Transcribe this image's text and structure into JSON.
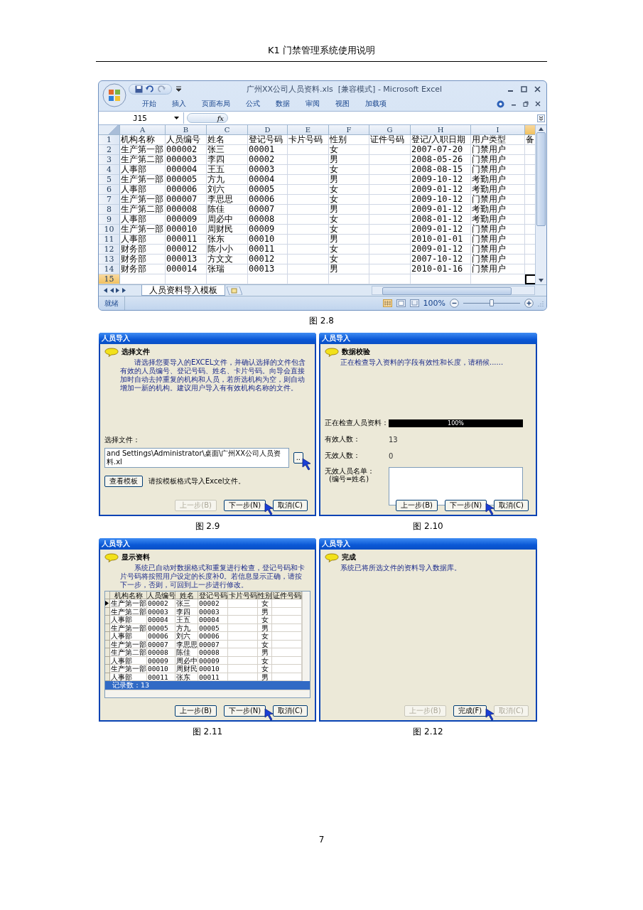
{
  "header": {
    "title": "K1 门禁管理系统使用说明"
  },
  "excel": {
    "title": "广州XX公司人员资料.xls  [兼容模式] - Microsoft Excel",
    "ribbon_tabs": [
      "开始",
      "插入",
      "页面布局",
      "公式",
      "数据",
      "审阅",
      "视图",
      "加载项"
    ],
    "name_box": "J15",
    "formula_label": "fx",
    "columns": [
      {
        "letter": "A",
        "selected": false
      },
      {
        "letter": "B",
        "selected": false
      },
      {
        "letter": "C",
        "selected": false
      },
      {
        "letter": "D",
        "selected": false
      },
      {
        "letter": "E",
        "selected": false
      },
      {
        "letter": "F",
        "selected": false
      },
      {
        "letter": "G",
        "selected": false
      },
      {
        "letter": "H",
        "selected": false
      },
      {
        "letter": "I",
        "selected": false
      },
      {
        "selected": true
      }
    ],
    "rows": [
      {
        "num": "1",
        "selected": false,
        "cells": [
          "机构名称",
          "人员编号",
          "姓名",
          "登记号码",
          "卡片号码",
          "性别",
          "证件号码",
          "登记/入职日期",
          "用户类型",
          "备"
        ]
      },
      {
        "num": "2",
        "selected": false,
        "cells": [
          "生产第一部",
          "000002",
          "张三",
          "00001",
          null,
          "女",
          null,
          "2007-07-20",
          "门禁用户",
          null
        ]
      },
      {
        "num": "3",
        "selected": false,
        "cells": [
          "生产第二部",
          "000003",
          "李四",
          "00002",
          null,
          "男",
          null,
          "2008-05-26",
          "门禁用户",
          null
        ]
      },
      {
        "num": "4",
        "selected": false,
        "cells": [
          "人事部",
          "000004",
          "王五",
          "00003",
          null,
          "女",
          null,
          "2008-08-15",
          "门禁用户",
          null
        ]
      },
      {
        "num": "5",
        "selected": false,
        "cells": [
          "生产第一部",
          "000005",
          "方九",
          "00004",
          null,
          "男",
          null,
          "2009-10-12",
          "考勤用户",
          null
        ]
      },
      {
        "num": "6",
        "selected": false,
        "cells": [
          "人事部",
          "000006",
          "刘六",
          "00005",
          null,
          "女",
          null,
          "2009-01-12",
          "考勤用户",
          null
        ]
      },
      {
        "num": "7",
        "selected": false,
        "cells": [
          "生产第一部",
          "000007",
          "李思思",
          "00006",
          null,
          "女",
          null,
          "2009-10-12",
          "门禁用户",
          null
        ]
      },
      {
        "num": "8",
        "selected": false,
        "cells": [
          "生产第二部",
          "000008",
          "陈佳",
          "00007",
          null,
          "男",
          null,
          "2009-01-12",
          "考勤用户",
          null
        ]
      },
      {
        "num": "9",
        "selected": false,
        "cells": [
          "人事部",
          "000009",
          "周必中",
          "00008",
          null,
          "女",
          null,
          "2008-01-12",
          "考勤用户",
          null
        ]
      },
      {
        "num": "10",
        "selected": false,
        "cells": [
          "生产第一部",
          "000010",
          "周财民",
          "00009",
          null,
          "女",
          null,
          "2009-01-12",
          "门禁用户",
          null
        ]
      },
      {
        "num": "11",
        "selected": false,
        "cells": [
          "人事部",
          "000011",
          "张东",
          "00010",
          null,
          "男",
          null,
          "2010-01-01",
          "门禁用户",
          null
        ]
      },
      {
        "num": "12",
        "selected": false,
        "cells": [
          "财务部",
          "000012",
          "陈小小",
          "00011",
          null,
          "女",
          null,
          "2009-01-12",
          "门禁用户",
          null
        ]
      },
      {
        "num": "13",
        "selected": false,
        "cells": [
          "财务部",
          "000013",
          "方文文",
          "00012",
          null,
          "女",
          null,
          "2007-10-12",
          "门禁用户",
          null
        ]
      },
      {
        "num": "14",
        "selected": false,
        "cells": [
          "财务部",
          "000014",
          "张瑞",
          "00013",
          null,
          "男",
          null,
          "2010-01-16",
          "门禁用户",
          null
        ]
      },
      {
        "num": "15",
        "selected": true
      }
    ],
    "sheet_tab": "人员资料导入模板",
    "status": "就绪",
    "zoom": "100%",
    "zoom_slider": {
      "level": 0.5
    },
    "caption": "图 2.8"
  },
  "dialogs": [
    {
      "kind": "file",
      "title": "人员导入",
      "heading": "选择文件",
      "description": "请选择您要导入的EXCEL文件，并确认选择的文件包含有效的人员编号、登记号码、姓名、卡片号码。向导会直接加时自动去掉重复的机构和人员，若所选机构为空，则自动增加一新的机构。建议用户导入有有效机构名称的文件。",
      "file_label": "选择文件：",
      "file_path": "and Settings\\Administrator\\桌面\\广州XX公司人员资料.xl",
      "browse": {
        "label": "..",
        "cursor": true
      },
      "template_button": "查看模板",
      "template_note": "请按模板格式导入Excel文件。",
      "buttons": [
        {
          "label": "上一步(B)",
          "disabled": true,
          "cursor": false
        },
        {
          "label": "下一步(N)",
          "disabled": false,
          "cursor": true
        },
        {
          "label": "取消(C)",
          "disabled": false,
          "cursor": false
        }
      ],
      "caption": "图 2.9"
    },
    {
      "kind": "check",
      "title": "人员导入",
      "heading": "数据校验",
      "description": "正在检查导入资料的字段有效性和长度，请稍候......",
      "progress_label": "正在检查人员资料：",
      "progress": {
        "level": 1,
        "text": "100%"
      },
      "valid_label": "有效人数：",
      "valid_count": "13",
      "invalid_label": "无效人数：",
      "invalid_count": "0",
      "invalid_list_label": "无效人员名单：",
      "invalid_list_hint": "(编号=姓名)",
      "buttons": [
        {
          "label": "上一步(B)",
          "disabled": false,
          "cursor": false
        },
        {
          "label": "下一步(N)",
          "disabled": false,
          "cursor": true
        },
        {
          "label": "取消(C)",
          "disabled": false,
          "cursor": false
        }
      ],
      "caption": "图 2.10"
    },
    {
      "kind": "preview",
      "title": "人员导入",
      "heading": "显示资料",
      "description": "系统已自动对数据格式和重复进行检查，登记号码和卡片号码将按照用户设定的长度补0。若信息显示正确，请按下一步，否则，可回到上一步进行修改。",
      "table": {
        "columns": [
          "机构名称",
          "人员编号",
          "姓名",
          "登记号码",
          "卡片号码",
          "性别",
          "证件号码"
        ],
        "rows": [
          {
            "selected": true,
            "cells": [
              "生产第一部",
              "00002",
              "张三",
              "00002",
              null,
              "女",
              null
            ]
          },
          {
            "selected": false,
            "cells": [
              "生产第二部",
              "00003",
              "李四",
              "00003",
              null,
              "男",
              null
            ]
          },
          {
            "selected": false,
            "cells": [
              "人事部",
              "00004",
              "王五",
              "00004",
              null,
              "女",
              null
            ]
          },
          {
            "selected": false,
            "cells": [
              "生产第一部",
              "00005",
              "方九",
              "00005",
              null,
              "男",
              null
            ]
          },
          {
            "selected": false,
            "cells": [
              "人事部",
              "00006",
              "刘六",
              "00006",
              null,
              "女",
              null
            ]
          },
          {
            "selected": false,
            "cells": [
              "生产第一部",
              "00007",
              "李思思",
              "00007",
              null,
              "女",
              null
            ]
          },
          {
            "selected": false,
            "cells": [
              "生产第二部",
              "00008",
              "陈佳",
              "00008",
              null,
              "男",
              null
            ]
          },
          {
            "selected": false,
            "cells": [
              "人事部",
              "00009",
              "周必中",
              "00009",
              null,
              "女",
              null
            ]
          },
          {
            "selected": false,
            "cells": [
              "生产第一部",
              "00010",
              "周财民",
              "00010",
              null,
              "女",
              null
            ]
          },
          {
            "selected": false,
            "cells": [
              "人事部",
              "00011",
              "张东",
              "00011",
              null,
              "男",
              null
            ]
          }
        ],
        "record_count": "记录数：13"
      },
      "buttons": [
        {
          "label": "上一步(B)",
          "disabled": false,
          "cursor": false
        },
        {
          "label": "下一步(N)",
          "disabled": false,
          "cursor": true
        },
        {
          "label": "取消(C)",
          "disabled": false,
          "cursor": false
        }
      ],
      "caption": "图 2.11"
    },
    {
      "kind": "done",
      "title": "人员导入",
      "heading": "完成",
      "description": "系统已将所选文件的资料导入数据库。",
      "buttons": [
        {
          "label": "上一步(B)",
          "disabled": true,
          "cursor": false
        },
        {
          "label": "完成(F)",
          "disabled": false,
          "cursor": true
        },
        {
          "label": "取消(C)",
          "disabled": true,
          "cursor": false
        }
      ],
      "caption": "图 2.12"
    }
  ],
  "page_number": "7"
}
